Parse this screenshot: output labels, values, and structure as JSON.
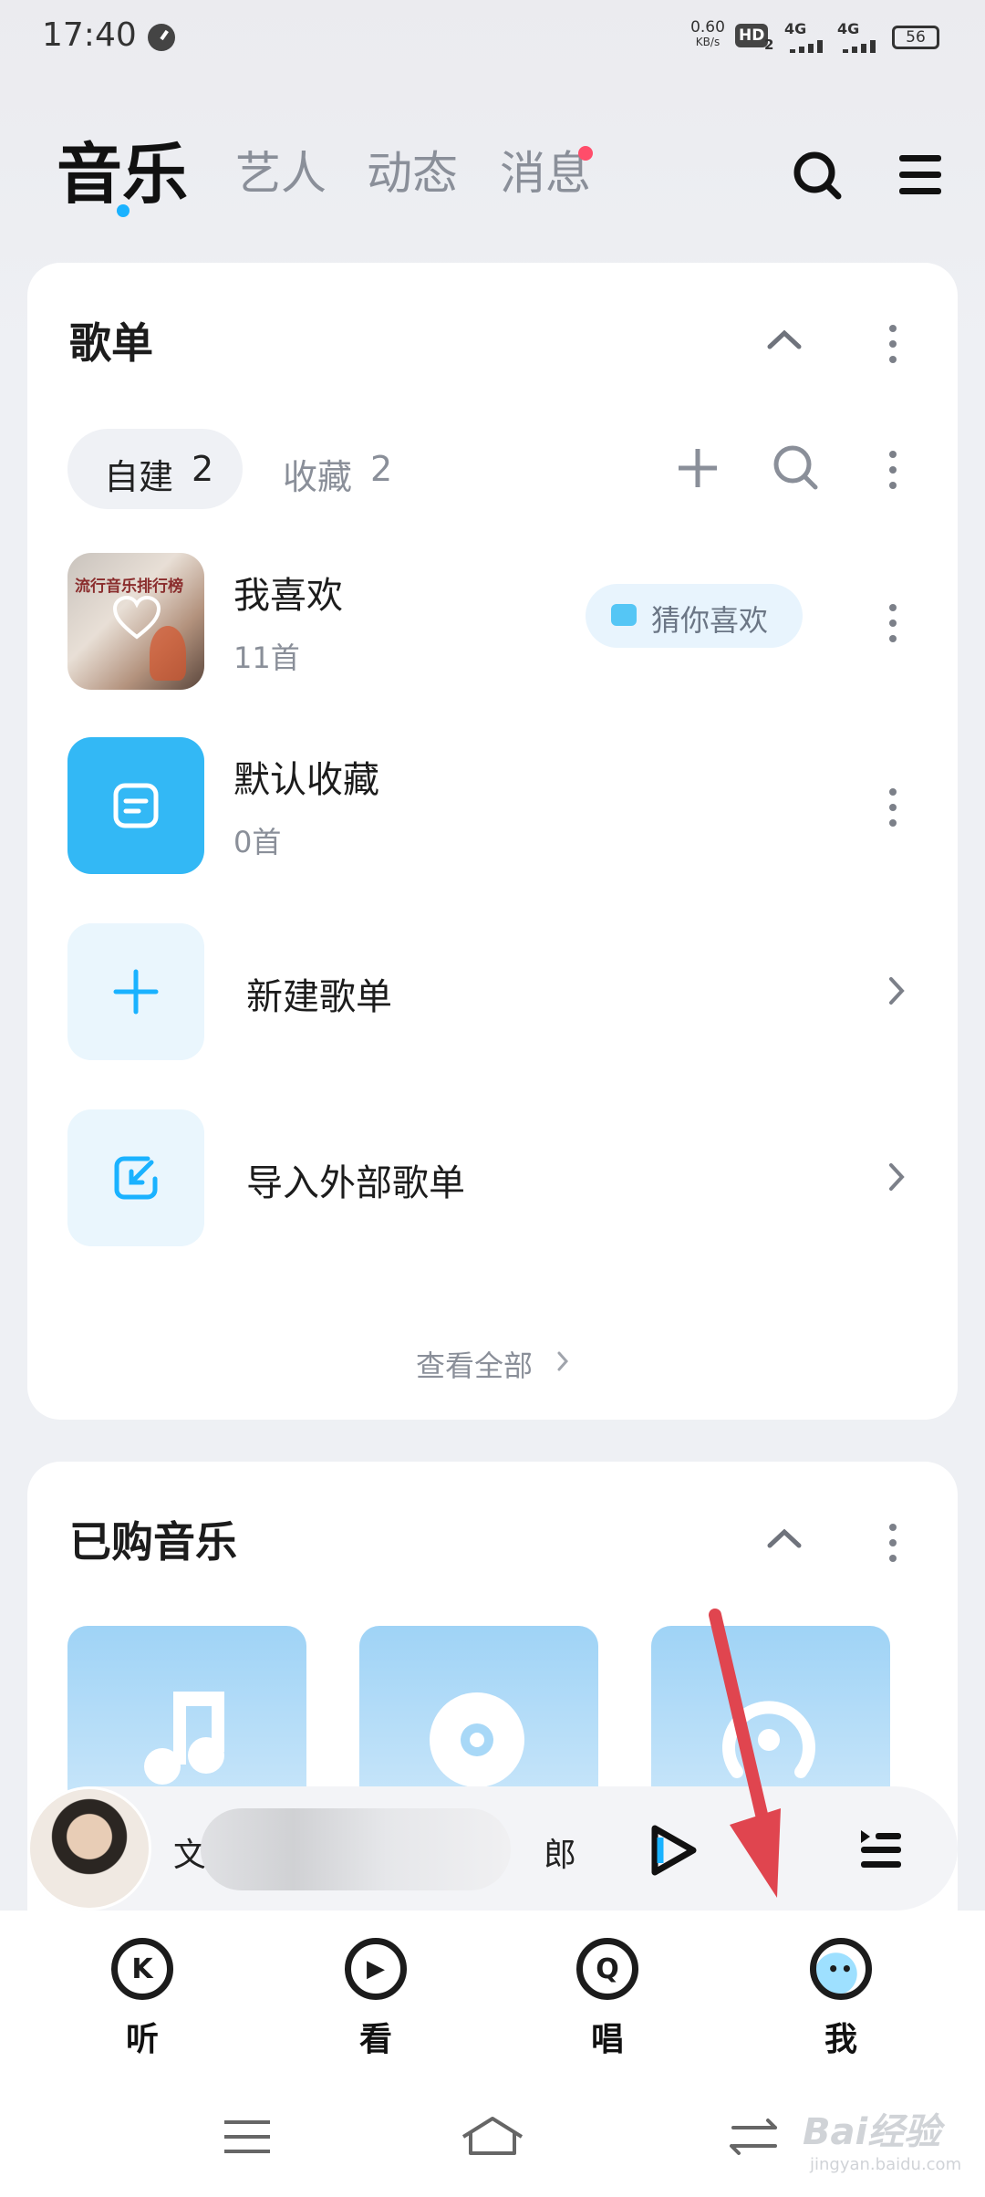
{
  "status": {
    "time": "17:40",
    "net_speed": "0.60",
    "net_unit": "KB/s",
    "hd": "HD",
    "hd_sub": "2",
    "sig1": "4G",
    "sig2": "4G",
    "battery": "56"
  },
  "header": {
    "tabs": [
      "音乐",
      "艺人",
      "动态",
      "消息"
    ]
  },
  "playlist_card": {
    "title": "歌单",
    "chips": [
      {
        "label": "自建",
        "count": "2"
      },
      {
        "label": "收藏",
        "count": "2"
      }
    ],
    "items": [
      {
        "title": "我喜欢",
        "sub": "11首",
        "badge": "猜你喜欢",
        "cover_text": "流行音乐排行榜"
      },
      {
        "title": "默认收藏",
        "sub": "0首"
      },
      {
        "title": "新建歌单"
      },
      {
        "title": "导入外部歌单"
      }
    ],
    "view_all": "查看全部"
  },
  "purchased_card": {
    "title": "已购音乐"
  },
  "player": {
    "text_left": "文",
    "text_right": "郎"
  },
  "bottom_nav": [
    {
      "label": "听",
      "icon_char": "K"
    },
    {
      "label": "看",
      "icon_char": "▶"
    },
    {
      "label": "唱",
      "icon_char": "Q"
    },
    {
      "label": "我",
      "icon_char": "••"
    }
  ],
  "watermark": {
    "text": "Bai经验",
    "sub": "jingyan.baidu.com"
  },
  "colors": {
    "accent": "#1ab2ff",
    "badge_bg": "#e8f4fd",
    "arrow": "#e0454f"
  }
}
